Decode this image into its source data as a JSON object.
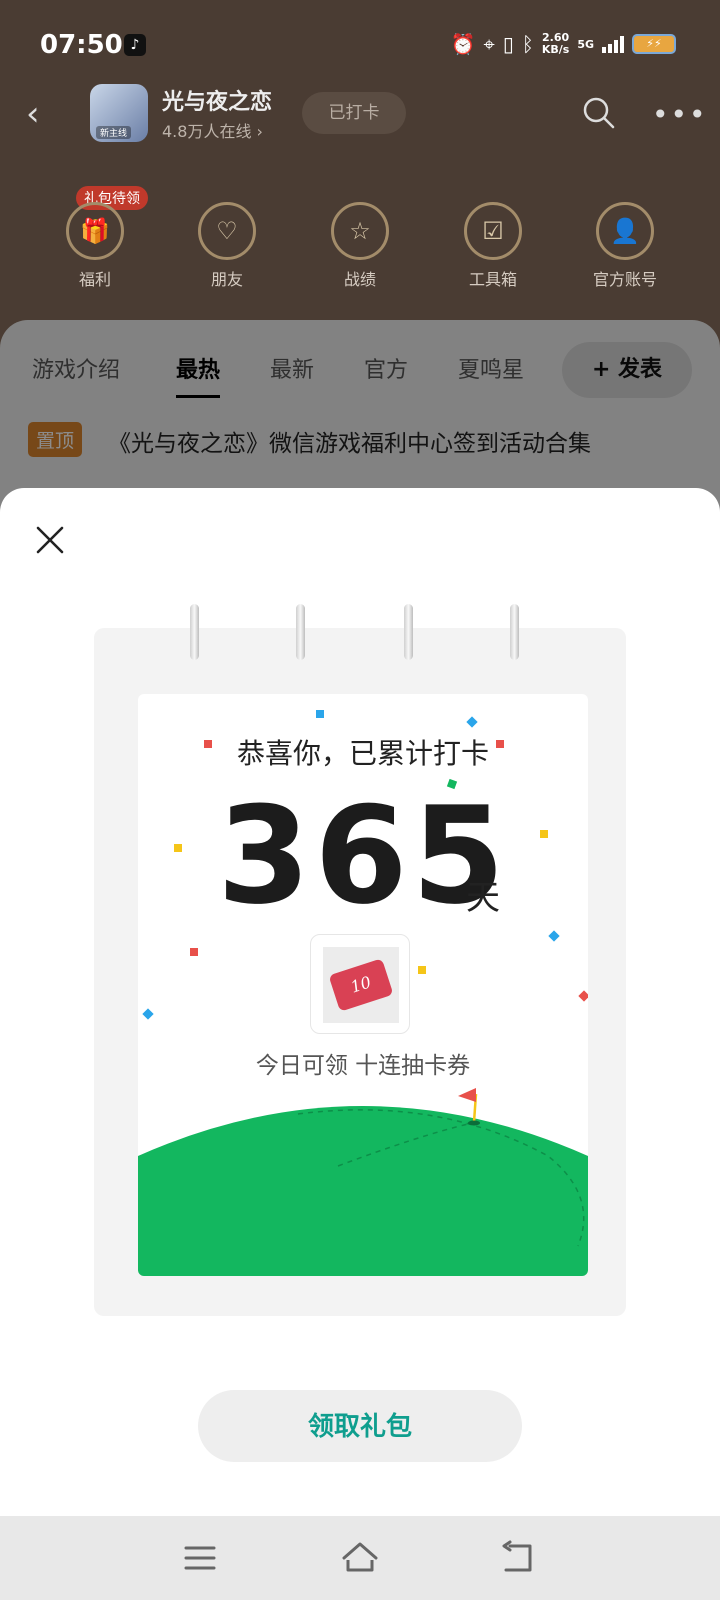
{
  "status_bar": {
    "time": "07:50",
    "net_speed_value": "2.60",
    "net_speed_unit": "KB/s",
    "network": "5G"
  },
  "header": {
    "game_title": "光与夜之恋",
    "online_count": "4.8万人在线",
    "online_chevron": "›",
    "checked_in_label": "已打卡",
    "avatar_tag": "新主线"
  },
  "features": {
    "gift_badge": "礼包待领",
    "items": [
      {
        "label": "福利",
        "icon": "gift-icon"
      },
      {
        "label": "朋友",
        "icon": "heart-eye-icon"
      },
      {
        "label": "战绩",
        "icon": "calendar-star-icon"
      },
      {
        "label": "工具箱",
        "icon": "calendar-check-icon"
      },
      {
        "label": "官方账号",
        "icon": "user-icon"
      }
    ]
  },
  "tabs": [
    {
      "label": "游戏介绍"
    },
    {
      "label": "最热",
      "active": true
    },
    {
      "label": "最新"
    },
    {
      "label": "官方"
    },
    {
      "label": "夏鸣星"
    }
  ],
  "post_button": "+ 发表",
  "pinned": {
    "badge": "置顶",
    "title": "《光与夜之恋》微信游戏福利中心签到活动合集"
  },
  "modal": {
    "heading": "恭喜你，已累计打卡",
    "count": "365",
    "unit": "天",
    "reward_label": "今日可领 十连抽卡券",
    "ticket_text": "10",
    "claim_button": "领取礼包"
  },
  "colors": {
    "accent_green": "#13b75f",
    "claim_text": "#0f9e8e",
    "flag_red": "#e8504a"
  }
}
